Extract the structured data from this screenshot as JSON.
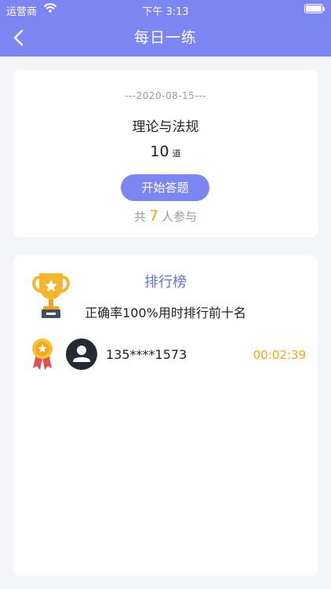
{
  "status_bar": {
    "carrier": "运营商",
    "time": "下午 3:13"
  },
  "nav": {
    "title": "每日一练",
    "back_icon": "chevron-left-icon"
  },
  "quiz": {
    "date": "---2020-08-15---",
    "subject": "理论与法规",
    "question_count": "10",
    "question_unit": "道",
    "start_button": "开始答题",
    "participants_prefix": "共",
    "participants_count": "7",
    "participants_suffix": "人参与"
  },
  "leaderboard": {
    "title": "排行榜",
    "subtitle": "正确率100%用时排行前十名",
    "entries": [
      {
        "rank_icon": "gold-medal-icon",
        "avatar_icon": "user-avatar-icon",
        "phone": "135****1573",
        "time": "00:02:39"
      }
    ]
  },
  "colors": {
    "primary": "#7b86f2",
    "accent": "#f3a51f",
    "background": "#f4f5f9"
  }
}
